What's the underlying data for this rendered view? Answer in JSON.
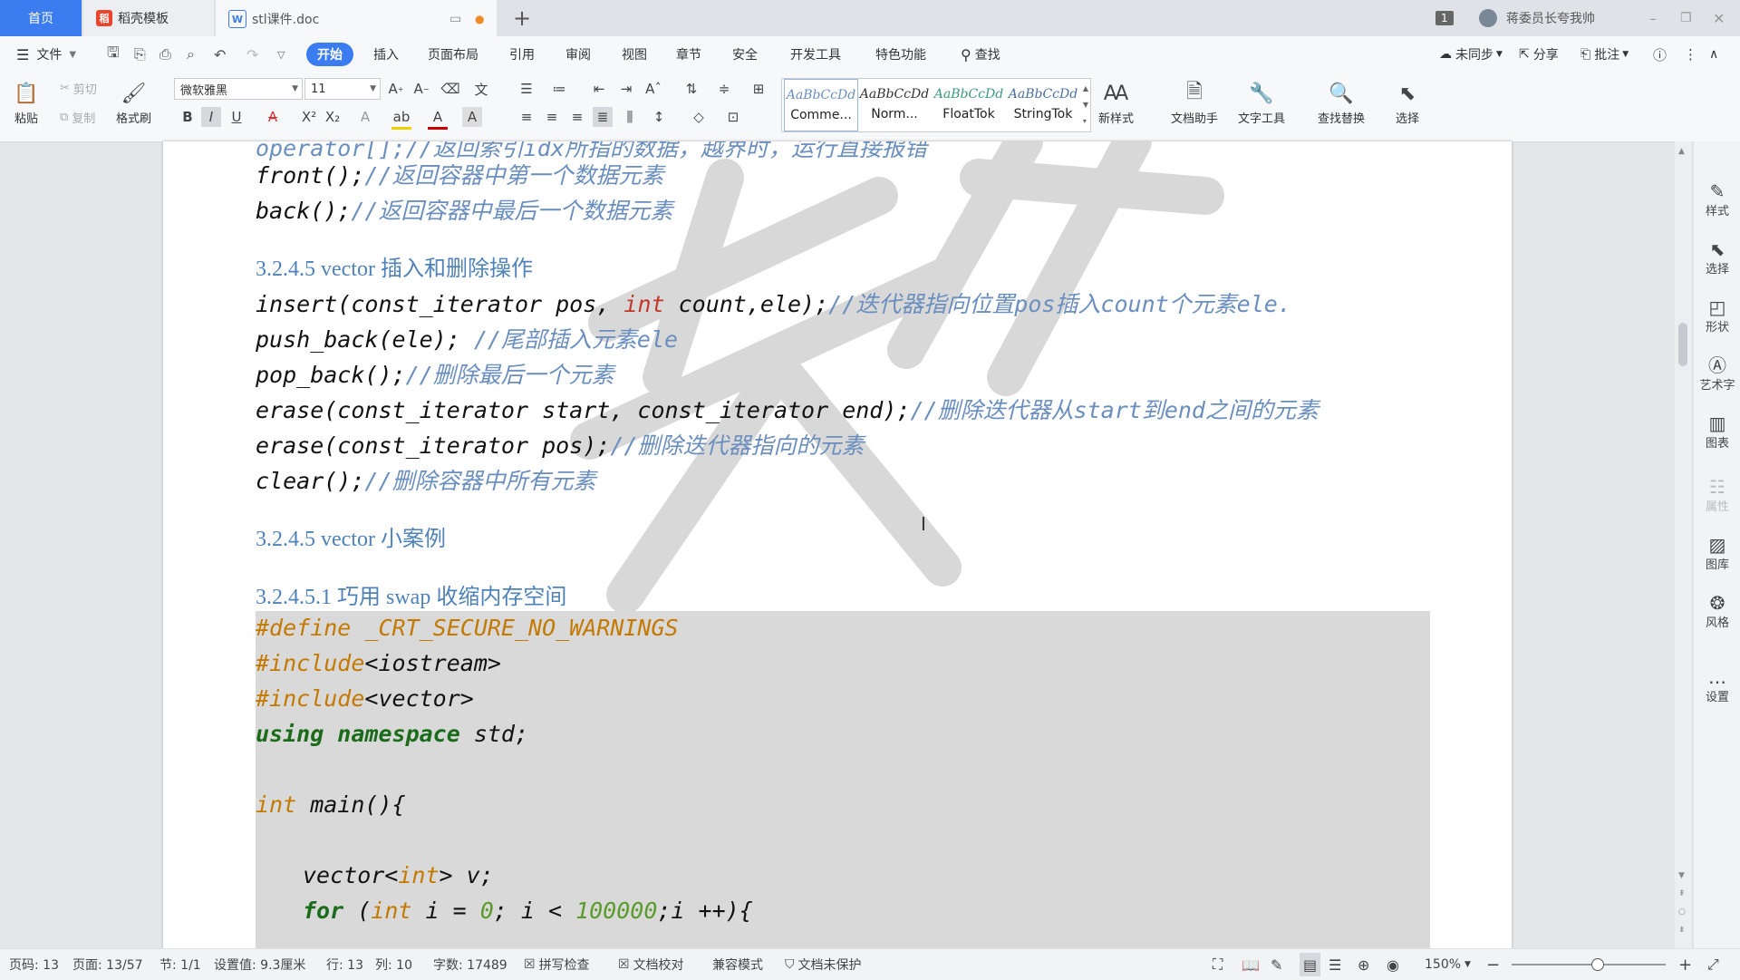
{
  "tabs": {
    "home": "首页",
    "template": "稻壳模板",
    "document": "stl课件.doc",
    "add": "+",
    "window_badge": "1",
    "user": "蒋委员长夸我帅"
  },
  "menu": {
    "file": "文件",
    "items": [
      "开始",
      "插入",
      "页面布局",
      "引用",
      "审阅",
      "视图",
      "章节",
      "安全",
      "开发工具",
      "特色功能"
    ],
    "search": "查找",
    "sync": "未同步",
    "share": "分享",
    "comment": "批注"
  },
  "ribbon": {
    "paste": "粘贴",
    "cut": "剪切",
    "copy": "复制",
    "format_painter": "格式刷",
    "font_name": "微软雅黑",
    "font_size": "11",
    "styles": [
      {
        "preview": "AaBbCcDd",
        "name": "Comme..."
      },
      {
        "preview": "AaBbCcDd",
        "name": "Norm..."
      },
      {
        "preview": "AaBbCcDd",
        "name": "FloatTok"
      },
      {
        "preview": "AaBbCcDd",
        "name": "StringTok"
      }
    ],
    "new_style": "新样式",
    "doc_assistant": "文档助手",
    "text_tools": "文字工具",
    "find_replace": "查找替换",
    "select": "选择"
  },
  "document": {
    "lines": {
      "l0": "operator[];//返回索引idx所指的数据，越界时，运行直接报错",
      "front_code": "front();",
      "front_cm": "//返回容器中第一个数据元素",
      "back_code": "back();",
      "back_cm": "//返回容器中最后一个数据元素",
      "h1": "3.2.4.5 vector 插入和删除操作",
      "insert_code_a": "insert(const_iterator pos, ",
      "insert_kw": "int",
      "insert_code_b": " count,ele);",
      "insert_cm": "//迭代器指向位置pos插入count个元素ele.",
      "push_code": "push_back(ele); ",
      "push_cm": "//尾部插入元素ele",
      "pop_code": "pop_back();",
      "pop_cm": "//删除最后一个元素",
      "erase1_code": "erase(const_iterator start, const_iterator end);",
      "erase1_cm": "//删除迭代器从start到end之间的元素",
      "erase2_code": "erase(const_iterator pos);",
      "erase2_cm": "//删除迭代器指向的元素",
      "clear_code": "clear();",
      "clear_cm": "//删除容器中所有元素",
      "h2": "3.2.4.5 vector 小案例",
      "h3": "3.2.4.5.1  巧用 swap 收缩内存空间"
    },
    "code": {
      "c1": "#define _CRT_SECURE_NO_WARNINGS",
      "c2_kw": "#include",
      "c2_rest": "<iostream>",
      "c3_kw": "#include",
      "c3_rest": "<vector>",
      "c4_kw": "using namespace",
      "c4_rest": " std;",
      "c6_kw": "int",
      "c6_rest": " main(){",
      "c8_a": "vector<",
      "c8_kw": "int",
      "c8_b": "> v;",
      "c9_for": "for",
      "c9_a": " (",
      "c9_int": "int",
      "c9_b": " i = ",
      "c9_zero": "0",
      "c9_c": "; i < ",
      "c9_num": "100000",
      "c9_d": ";i ++){"
    }
  },
  "right_panel": [
    "样式",
    "选择",
    "形状",
    "艺术字",
    "图表",
    "属性",
    "图库",
    "风格",
    "设置"
  ],
  "status": {
    "page_code": "页码: 13",
    "pages": "页面: 13/57",
    "section": "节: 1/1",
    "setting": "设置值: 9.3厘米",
    "row": "行: 13",
    "col": "列: 10",
    "words": "字数: 17489",
    "spell": "拼写检查",
    "proof": "文档校对",
    "compat": "兼容模式",
    "protect": "文档未保护",
    "zoom": "150%"
  },
  "colors": {
    "accent": "#3b7cf0",
    "comment": "#6a8ebe",
    "keyword": "#c47a00",
    "heading": "#4f82b8",
    "code_bg": "#d9d9d9"
  }
}
